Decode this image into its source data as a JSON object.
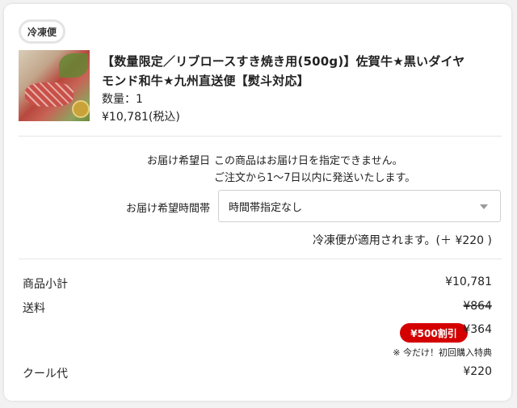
{
  "product": {
    "badge": "冷凍便",
    "title_line1": "【数量限定／リブロースすき焼き用(500g)】佐賀牛★黒いダイヤ",
    "title_line2": "モンド和牛★九州直送便【熨斗対応】",
    "quantity": "数量：1",
    "price": "¥10,781(税込)"
  },
  "delivery": {
    "date_label": "お届け希望日",
    "date_text1": "この商品はお届け日を指定できません。",
    "date_text2": "ご注文から1〜7日以内に発送いたします。",
    "time_label": "お届け希望時間帯",
    "time_value": "時間帯指定なし",
    "frozen_note": "冷凍便が適用されます。(＋ ¥220 )"
  },
  "summary": {
    "subtotal_label": "商品小計",
    "subtotal_value": "¥10,781",
    "shipping_label": "送料",
    "shipping_original": "¥864",
    "discount_badge": "¥500割引",
    "shipping_discounted": "¥364",
    "promo_note": "※ 今だけ！初回購入特典",
    "cool_label": "クール代",
    "cool_value": "¥220"
  },
  "icons": [
    "product-thumbnail",
    "chevron-down-icon"
  ],
  "colors": {
    "discount": "#d40000",
    "divider": "#e6e6e6"
  }
}
